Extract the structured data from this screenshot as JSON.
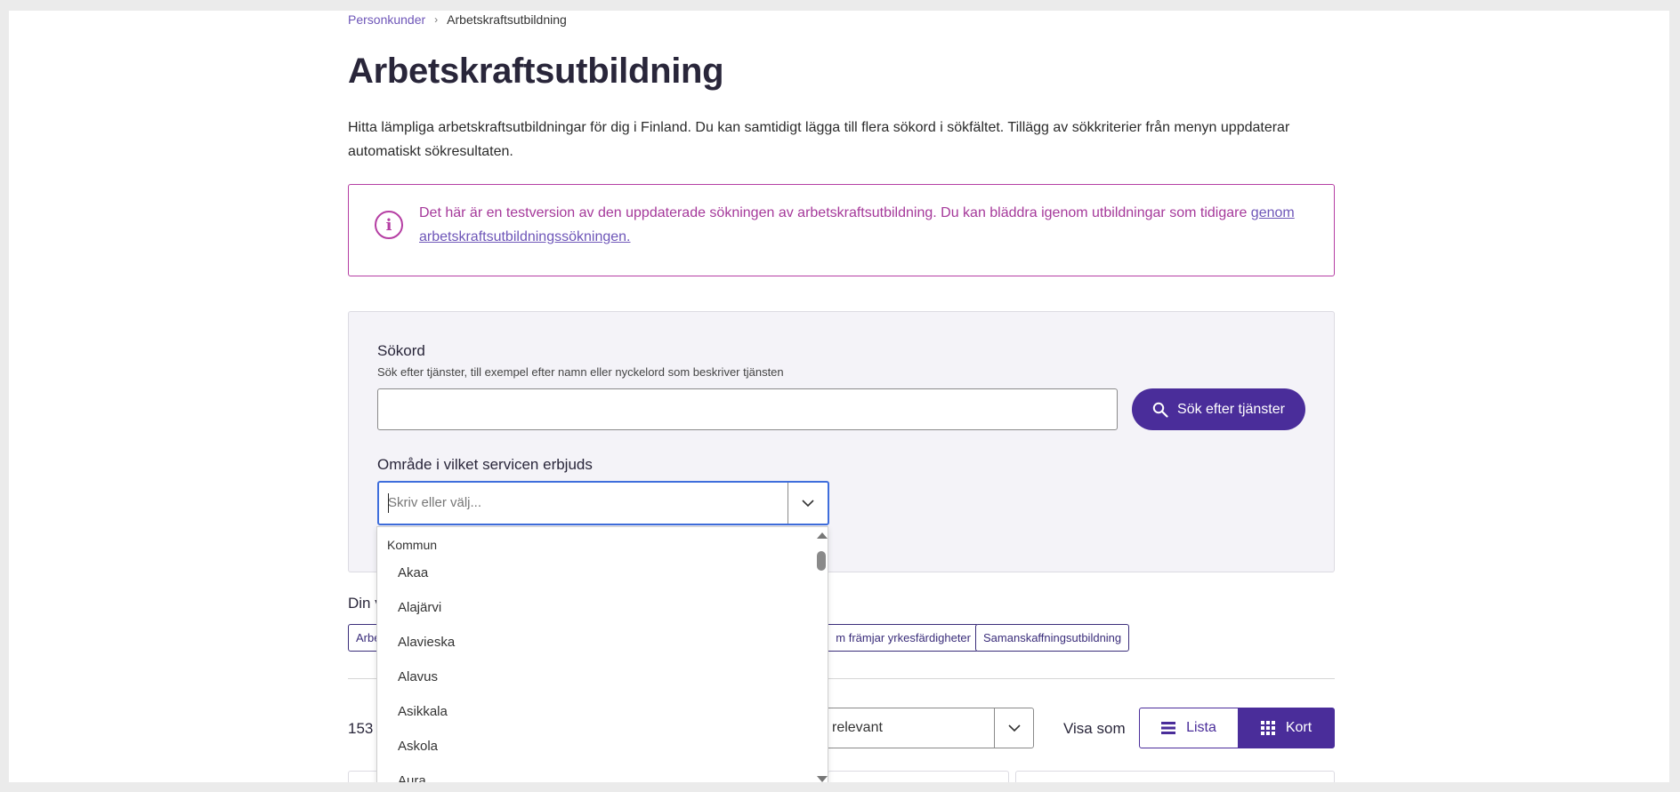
{
  "breadcrumb": {
    "home": "Personkunder",
    "separator": "›",
    "current": "Arbetskraftsutbildning"
  },
  "page_title": "Arbetskraftsutbildning",
  "intro": "Hitta lämpliga arbetskraftsutbildningar för dig i Finland. Du kan samtidigt lägga till flera sökord i sökfältet. Tillägg av sökkriterier från menyn uppdaterar automatiskt sökresultaten.",
  "notice": {
    "text": "Det här är en testversion av den uppdaterade sökningen av arbetskraftsutbildning. Du kan bläddra igenom utbildningar som tidigare ",
    "link": "genom arbetskraftsutbildningssökningen.",
    "icon": "info-icon"
  },
  "search": {
    "keyword_label": "Sökord",
    "keyword_hint": "Sök efter tjänster, till exempel efter namn eller nyckelord som beskriver tjänsten",
    "keyword_value": "",
    "button_label": "Sök efter tjänster",
    "area_label": "Område i vilket servicen erbjuds",
    "area_placeholder": "Skriv eller välj..."
  },
  "dropdown": {
    "group_label": "Kommun",
    "options": [
      "Akaa",
      "Alajärvi",
      "Alavieska",
      "Alavus",
      "Asikkala",
      "Askola",
      "Aura"
    ]
  },
  "selections": {
    "label": "Din v",
    "chips": [
      "Arbe",
      "m främjar yrkesfärdigheter",
      "Samanskaffningsutbildning"
    ]
  },
  "results": {
    "count": "153 t",
    "sort_value": "relevant",
    "view_label": "Visa som",
    "view_list": "Lista",
    "view_cards": "Kort",
    "active_view": "Kort"
  },
  "colors": {
    "primary": "#4a2d9a",
    "notice": "#b53ea3",
    "link": "#6e56b8",
    "focus": "#3f6edc",
    "panel_bg": "#f4f3f8"
  }
}
